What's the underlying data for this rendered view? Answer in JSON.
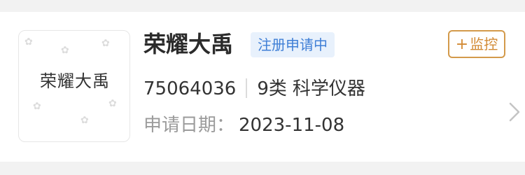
{
  "trademark": {
    "name": "荣耀大禹",
    "status": "注册申请中",
    "logo_text": "荣耀大禹",
    "registration_number": "75064036",
    "class_number": "9类",
    "class_name": "科学仪器",
    "apply_date_label": "申请日期：",
    "apply_date": "2023-11-08"
  },
  "actions": {
    "monitor_plus": "+",
    "monitor_label": "监控"
  },
  "icons": {
    "chevron": "chevron-right-icon"
  },
  "colors": {
    "status_bg": "#e8f1fc",
    "status_text": "#3f7fd6",
    "monitor_accent": "#d28a34",
    "label_gray": "#9b9b9b"
  }
}
